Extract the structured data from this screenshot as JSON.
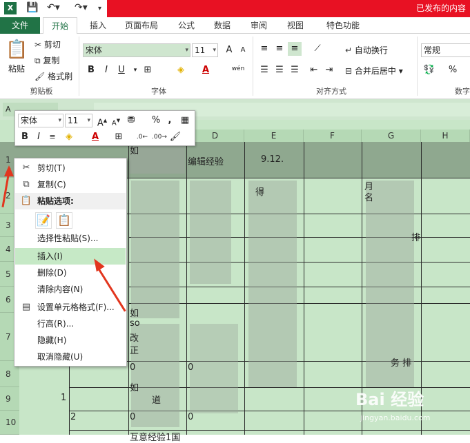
{
  "titlebar": {
    "app_icon": "X",
    "right_text": "已发布的内容"
  },
  "tabs": [
    "文件",
    "开始",
    "插入",
    "页面布局",
    "公式",
    "数据",
    "审阅",
    "视图",
    "特色功能"
  ],
  "clipboard": {
    "paste": "粘贴",
    "cut": "剪切",
    "copy": "复制",
    "format_painter": "格式刷",
    "group": "剪贴板"
  },
  "font": {
    "name": "宋体",
    "size": "11",
    "group": "字体",
    "bold": "B",
    "italic": "I",
    "underline": "U",
    "grow": "A",
    "shrink": "A",
    "phonetic": "wén"
  },
  "align": {
    "wrap": "自动换行",
    "merge": "合并后居中",
    "group": "对齐方式"
  },
  "number": {
    "format": "常规",
    "group": "数字",
    "percent": "%"
  },
  "namebox": "A",
  "columns": [
    "D",
    "E",
    "F",
    "G",
    "H"
  ],
  "rows": [
    "1",
    "2",
    "3",
    "4",
    "5",
    "6",
    "7",
    "8",
    "9",
    "10"
  ],
  "cells": {
    "d1": "编辑经验",
    "e1": "9.12.",
    "c1": "如",
    "e2": "得",
    "g2a": "月",
    "g2b": "名",
    "g3": "排",
    "c6a": "如",
    "c6b": "so",
    "c6c": "改",
    "c6d": "正",
    "c7": "0",
    "d7": "0",
    "g7": "务 排",
    "c8": "如",
    "c8b": "道",
    "b9": "1",
    "b10": "2",
    "c10": "0",
    "d10": "0",
    "c10b": "互意经验1国"
  },
  "mini_toolbar": {
    "font": "宋体",
    "size": "11",
    "percent": "%",
    "comma": ",",
    "bold": "B",
    "italic": "I"
  },
  "context_menu": [
    {
      "label": "剪切(T)",
      "icon": "scissors-icon"
    },
    {
      "label": "复制(C)",
      "icon": "copy-icon"
    },
    {
      "label": "粘贴选项:",
      "icon": "paste-icon"
    },
    {
      "label": "选择性粘贴(S)...",
      "icon": ""
    },
    {
      "label": "插入(I)",
      "icon": ""
    },
    {
      "label": "删除(D)",
      "icon": ""
    },
    {
      "label": "清除内容(N)",
      "icon": ""
    },
    {
      "label": "设置单元格格式(F)...",
      "icon": "format-cells-icon"
    },
    {
      "label": "行高(R)...",
      "icon": ""
    },
    {
      "label": "隐藏(H)",
      "icon": ""
    },
    {
      "label": "取消隐藏(U)",
      "icon": ""
    }
  ],
  "watermark": {
    "main": "Bai 经验",
    "sub": "jingyan.baidu.com"
  },
  "colors": {
    "accent": "#217346",
    "arrow": "#e2361e",
    "sheet": "#c8e6c8"
  }
}
